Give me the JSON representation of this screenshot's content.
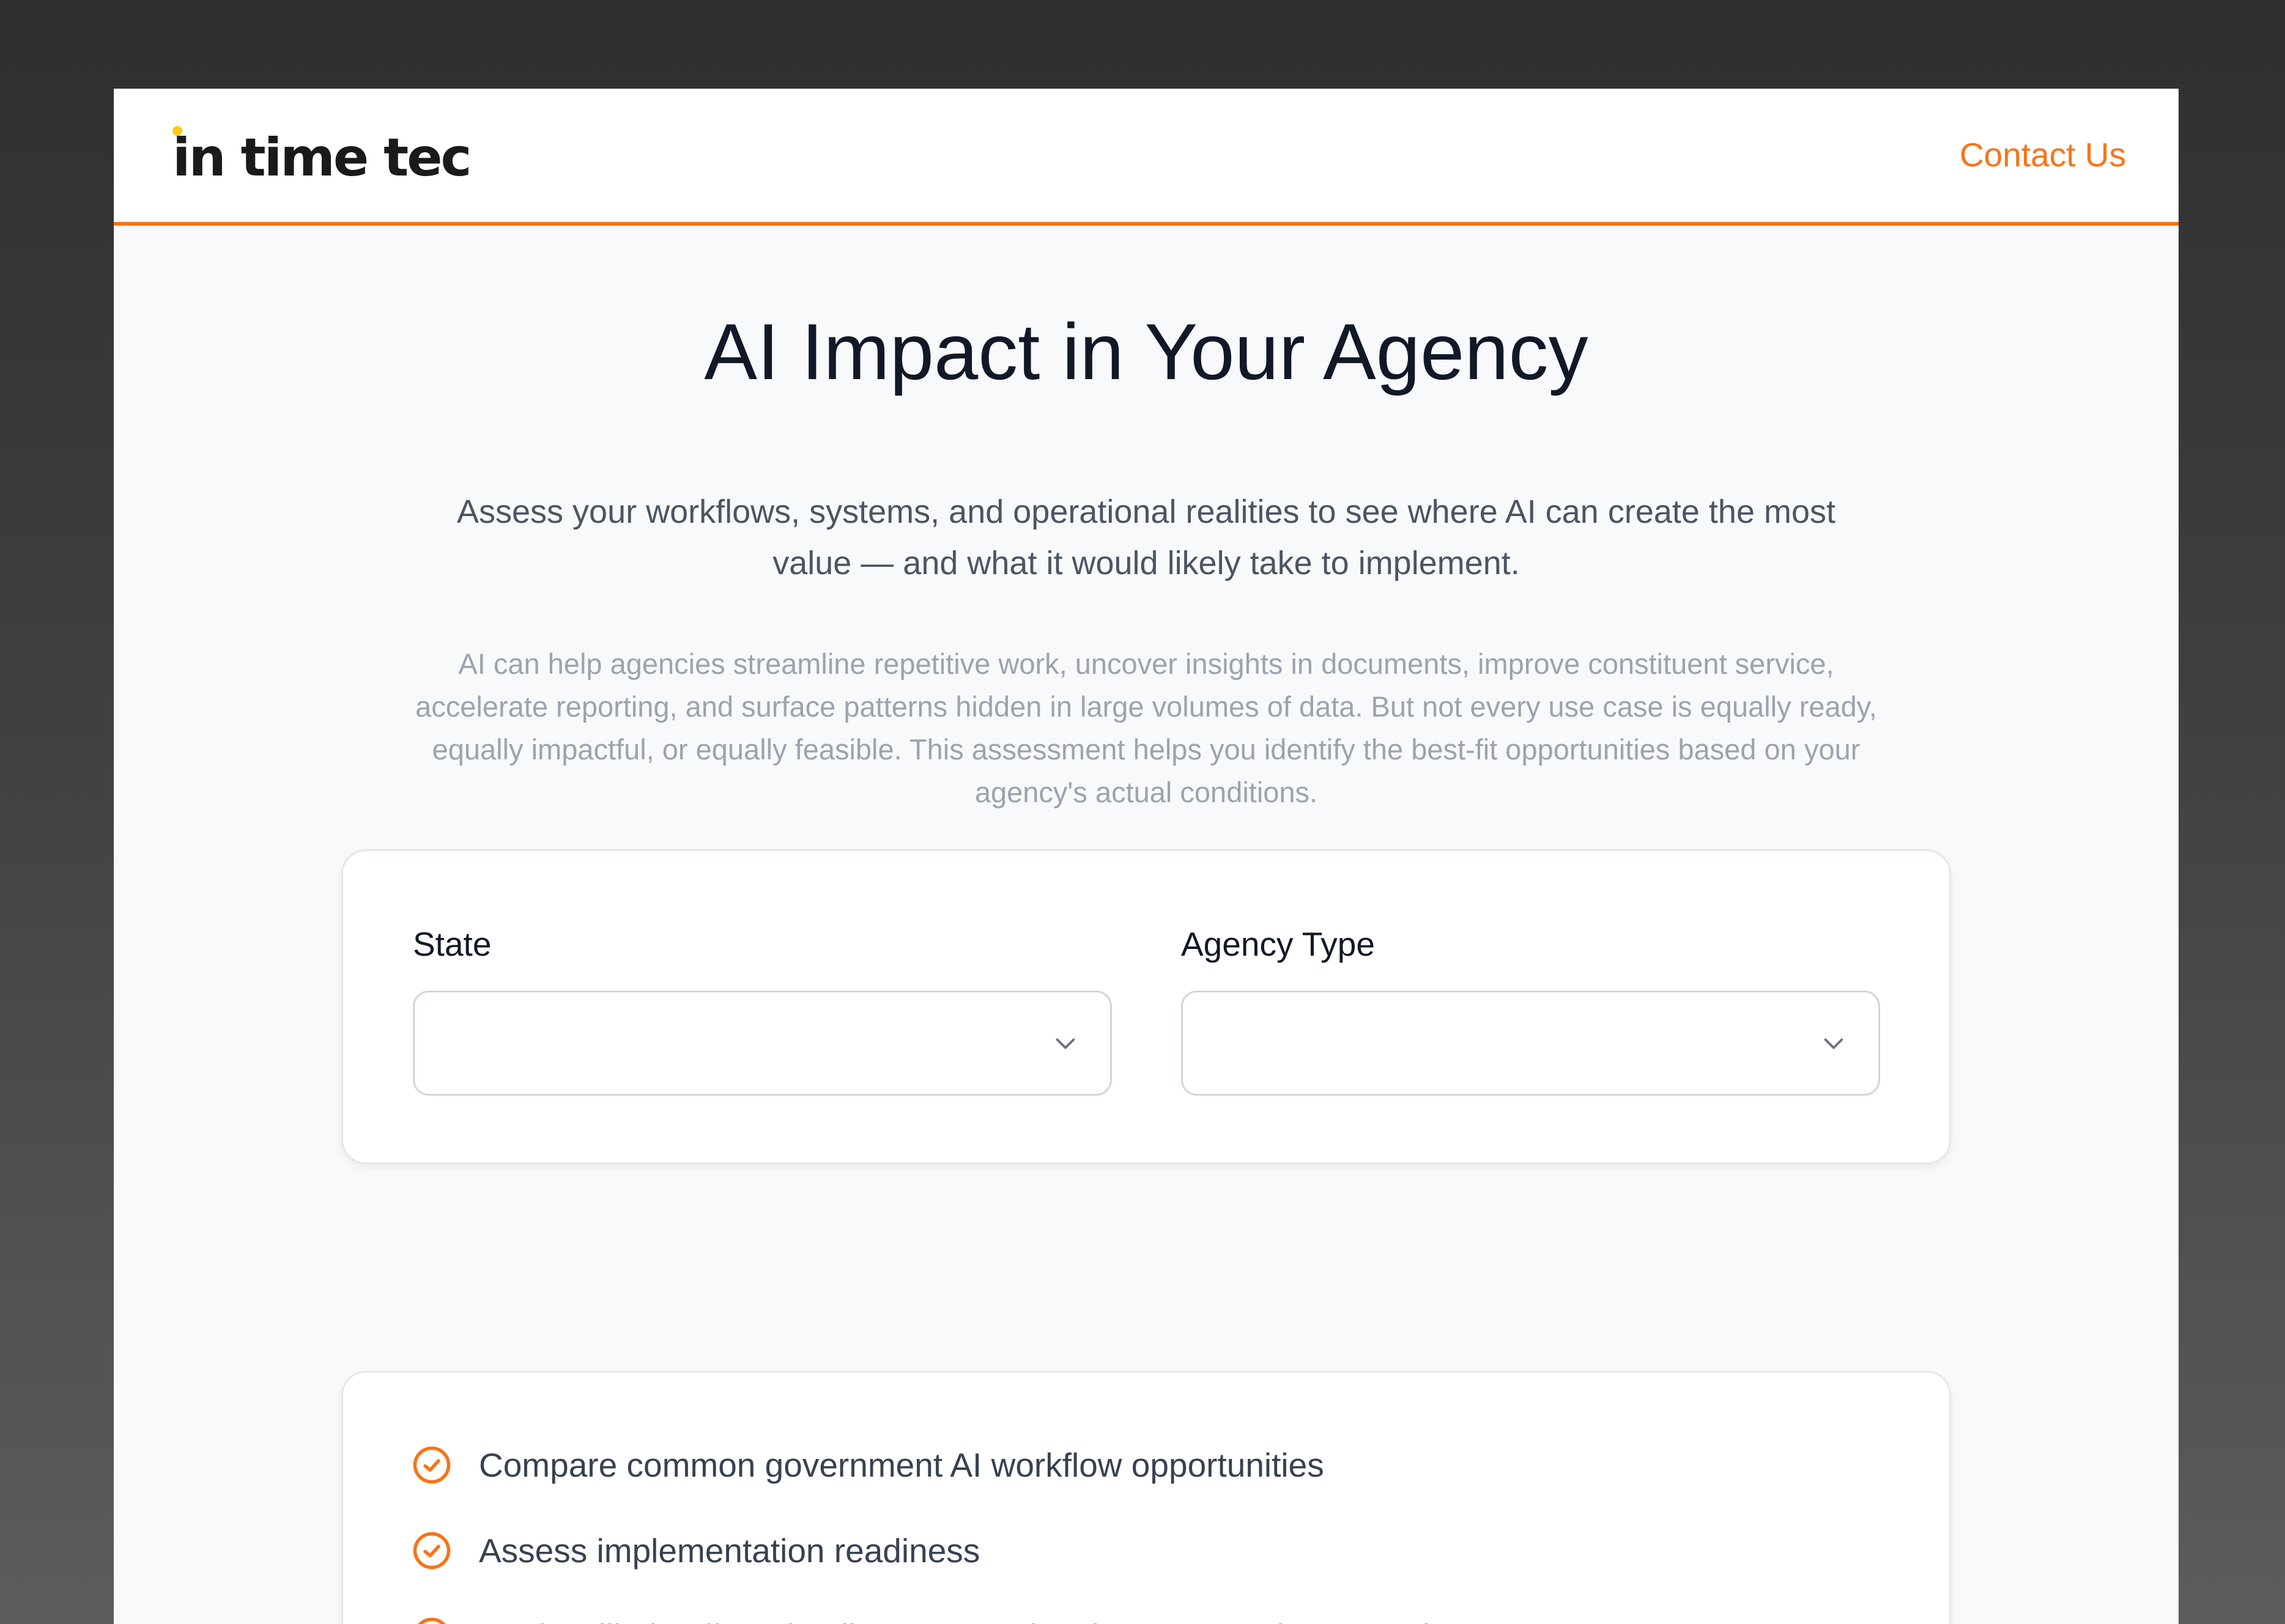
{
  "header": {
    "logo_text": "in time tec",
    "contact_label": "Contact Us"
  },
  "hero": {
    "title": "AI Impact in Your Agency",
    "subtitle": "Assess your workflows, systems, and operational realities to see where AI can create the most value — and what it would likely take to implement.",
    "description": "AI can help agencies streamline repetitive work, uncover insights in documents, improve constituent service, accelerate reporting, and surface patterns hidden in large volumes of data. But not every use case is equally ready, equally impactful, or equally feasible. This assessment helps you identify the best-fit opportunities based on your agency's actual conditions."
  },
  "filters": {
    "state": {
      "label": "State",
      "value": ""
    },
    "agency_type": {
      "label": "Agency Type",
      "value": ""
    }
  },
  "features": [
    {
      "icon": "check-circle-icon",
      "text": "Compare common government AI workflow opportunities"
    },
    {
      "icon": "check-circle-icon",
      "text": "Assess implementation readiness"
    },
    {
      "icon": "check-circle-icon",
      "text": "Review likely effort, timeline, agency involvement, and expected outcomes"
    }
  ],
  "colors": {
    "accent": "#f97316",
    "logo_dot_yellow": "#facc15",
    "title_text": "#111827",
    "page_background": "#f8f9fb"
  }
}
